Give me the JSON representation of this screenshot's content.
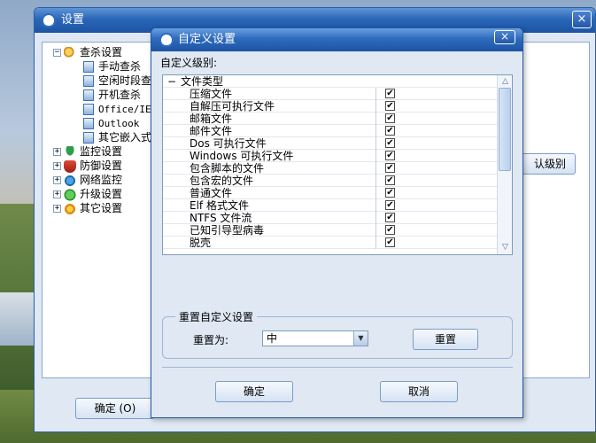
{
  "main_window": {
    "title": "设置",
    "close": "×",
    "tree": {
      "scan": {
        "label": "查杀设置",
        "expander": "−",
        "children": [
          "手动查杀",
          "空闲时段查",
          "开机查杀",
          "Office/IE",
          "Outlook",
          "其它嵌入式"
        ]
      },
      "groups": [
        {
          "label": "监控设置",
          "expander": "+"
        },
        {
          "label": "防御设置",
          "expander": "+"
        },
        {
          "label": "网络监控",
          "expander": "+"
        },
        {
          "label": "升级设置",
          "expander": "+"
        },
        {
          "label": "其它设置",
          "expander": "+"
        }
      ]
    },
    "default_level_btn": "认级别",
    "ok_btn": "确定 (O)"
  },
  "dialog": {
    "title": "自定义设置",
    "close": "×",
    "custom_level_label": "自定义级别:",
    "group_header": {
      "collapse": "−",
      "label": "文件类型"
    },
    "items": [
      {
        "label": "压缩文件",
        "checked": "✔"
      },
      {
        "label": "自解压可执行文件",
        "checked": "✔"
      },
      {
        "label": "邮箱文件",
        "checked": "✔"
      },
      {
        "label": "邮件文件",
        "checked": "✔"
      },
      {
        "label": "Dos 可执行文件",
        "checked": "✔"
      },
      {
        "label": "Windows 可执行文件",
        "checked": "✔"
      },
      {
        "label": "包含脚本的文件",
        "checked": "✔"
      },
      {
        "label": "包含宏的文件",
        "checked": "✔"
      },
      {
        "label": "普通文件",
        "checked": "✔"
      },
      {
        "label": "Elf 格式文件",
        "checked": "✔"
      },
      {
        "label": "NTFS 文件流",
        "checked": "✔"
      },
      {
        "label": "已知引导型病毒",
        "checked": "✔"
      },
      {
        "label": "脱壳",
        "checked": "✔"
      }
    ],
    "scroll_up": "△",
    "scroll_down": "▽",
    "reset_group": {
      "legend": "重置自定义设置",
      "label": "重置为:",
      "selected": "中",
      "button": "重置"
    },
    "ok_btn": "确定",
    "cancel_btn": "取消"
  },
  "colors": {
    "title_bar": "#2a66b8",
    "panel_bg": "#dfe8f3",
    "border": "#7f9db9"
  }
}
